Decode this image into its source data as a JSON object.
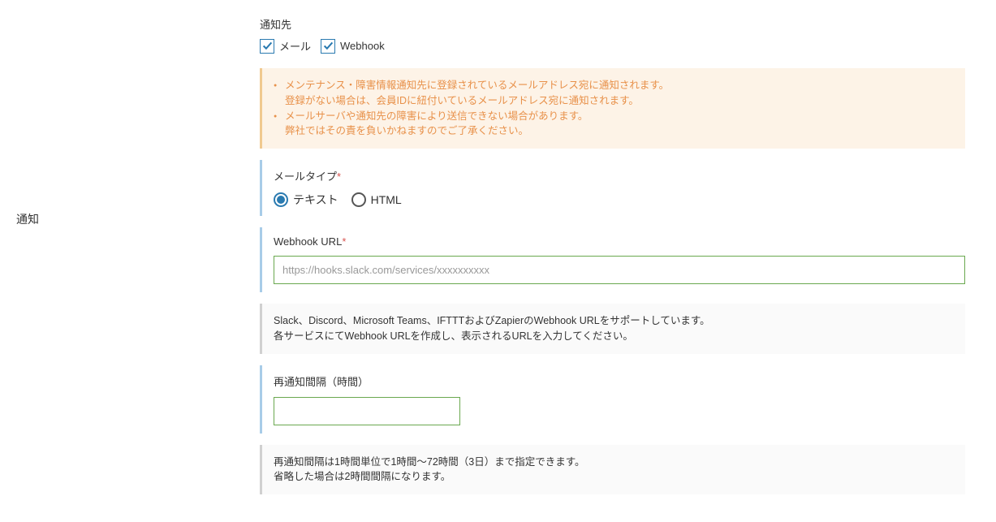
{
  "sidebar": {
    "title": "通知"
  },
  "destination": {
    "label": "通知先",
    "options": {
      "mail": "メール",
      "webhook": "Webhook"
    }
  },
  "notice": {
    "line1": "メンテナンス・障害情報通知先に登録されているメールアドレス宛に通知されます。",
    "line2": "登録がない場合は、会員IDに紐付いているメールアドレス宛に通知されます。",
    "line3": "メールサーバや通知先の障害により送信できない場合があります。",
    "line4": "弊社ではその責を負いかねますのでご了承ください。"
  },
  "mailType": {
    "label": "メールタイプ",
    "required": "*",
    "options": {
      "text": "テキスト",
      "html": "HTML"
    }
  },
  "webhook": {
    "label": "Webhook URL",
    "required": "*",
    "placeholder": "https://hooks.slack.com/services/xxxxxxxxxx",
    "help1": "Slack、Discord、Microsoft Teams、IFTTTおよびZapierのWebhook URLをサポートしています。",
    "help2": "各サービスにてWebhook URLを作成し、表示されるURLを入力してください。"
  },
  "interval": {
    "label": "再通知間隔（時間）",
    "help1": "再通知間隔は1時間単位で1時間～72時間（3日）まで指定できます。",
    "help2": "省略した場合は2時間間隔になります。"
  }
}
